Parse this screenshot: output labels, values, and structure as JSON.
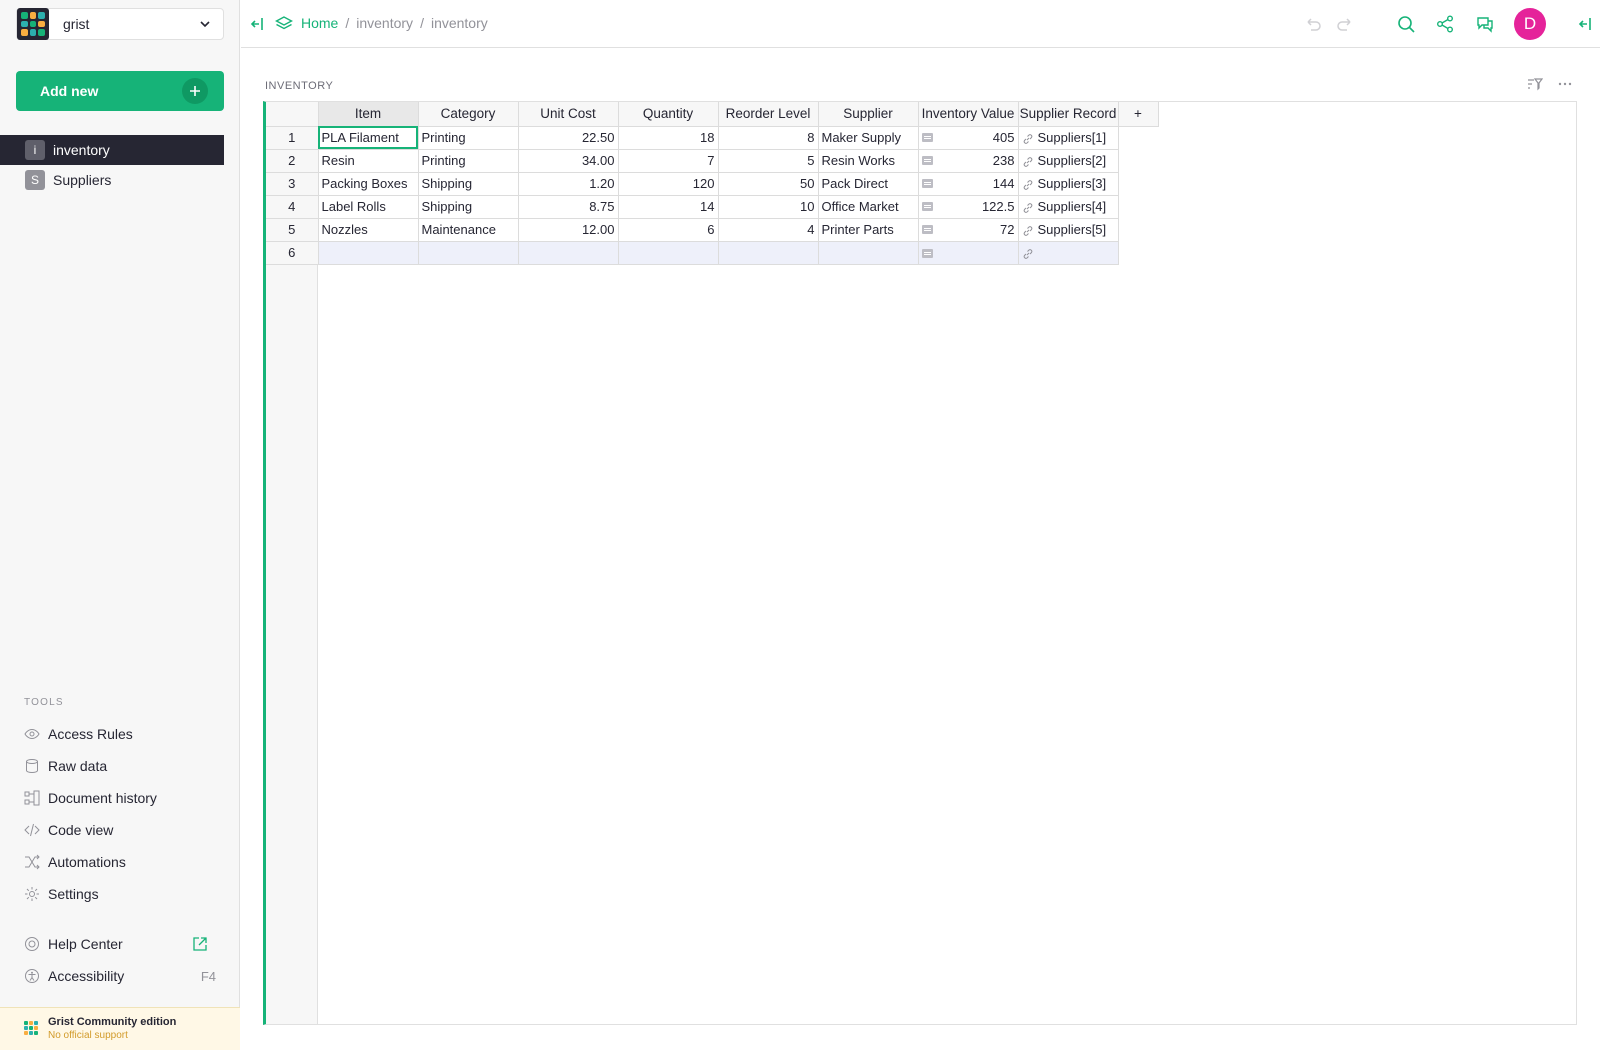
{
  "org": {
    "name": "grist"
  },
  "sidebar": {
    "add_new": "Add new",
    "pages": [
      {
        "initial": "i",
        "label": "inventory",
        "active": true
      },
      {
        "initial": "S",
        "label": "Suppliers",
        "active": false
      }
    ],
    "tools_label": "TOOLS",
    "tools": [
      {
        "label": "Access Rules",
        "icon": "eye-icon"
      },
      {
        "label": "Raw data",
        "icon": "database-icon"
      },
      {
        "label": "Document history",
        "icon": "history-icon"
      },
      {
        "label": "Code view",
        "icon": "code-icon"
      },
      {
        "label": "Automations",
        "icon": "shuffle-icon"
      },
      {
        "label": "Settings",
        "icon": "gear-icon"
      }
    ],
    "help": {
      "label": "Help Center"
    },
    "accessibility": {
      "label": "Accessibility",
      "shortcut": "F4"
    },
    "edition": {
      "title": "Grist Community edition",
      "subtitle": "No official support"
    }
  },
  "topbar": {
    "breadcrumb": {
      "home": "Home",
      "doc": "inventory",
      "page": "inventory",
      "sep": "/"
    },
    "avatar": "D"
  },
  "section": {
    "title": "INVENTORY"
  },
  "table": {
    "columns": [
      "Item",
      "Category",
      "Unit Cost",
      "Quantity",
      "Reorder Level",
      "Supplier",
      "Inventory Value",
      "Supplier Record"
    ],
    "add_column": "+",
    "rows": [
      {
        "n": "1",
        "item": "PLA Filament",
        "category": "Printing",
        "unit_cost": "22.50",
        "quantity": "18",
        "reorder": "8",
        "supplier": "Maker Supply",
        "value": "405",
        "record": "Suppliers[1]"
      },
      {
        "n": "2",
        "item": "Resin",
        "category": "Printing",
        "unit_cost": "34.00",
        "quantity": "7",
        "reorder": "5",
        "supplier": "Resin Works",
        "value": "238",
        "record": "Suppliers[2]"
      },
      {
        "n": "3",
        "item": "Packing Boxes",
        "category": "Shipping",
        "unit_cost": "1.20",
        "quantity": "120",
        "reorder": "50",
        "supplier": "Pack Direct",
        "value": "144",
        "record": "Suppliers[3]"
      },
      {
        "n": "4",
        "item": "Label Rolls",
        "category": "Shipping",
        "unit_cost": "8.75",
        "quantity": "14",
        "reorder": "10",
        "supplier": "Office Market",
        "value": "122.5",
        "record": "Suppliers[4]"
      },
      {
        "n": "5",
        "item": "Nozzles",
        "category": "Maintenance",
        "unit_cost": "12.00",
        "quantity": "6",
        "reorder": "4",
        "supplier": "Printer Parts",
        "value": "72",
        "record": "Suppliers[5]"
      }
    ],
    "new_row": {
      "n": "6"
    }
  },
  "colors": {
    "accent": "#16b378",
    "avatar": "#e5239a",
    "sidebar_active": "#262633"
  }
}
